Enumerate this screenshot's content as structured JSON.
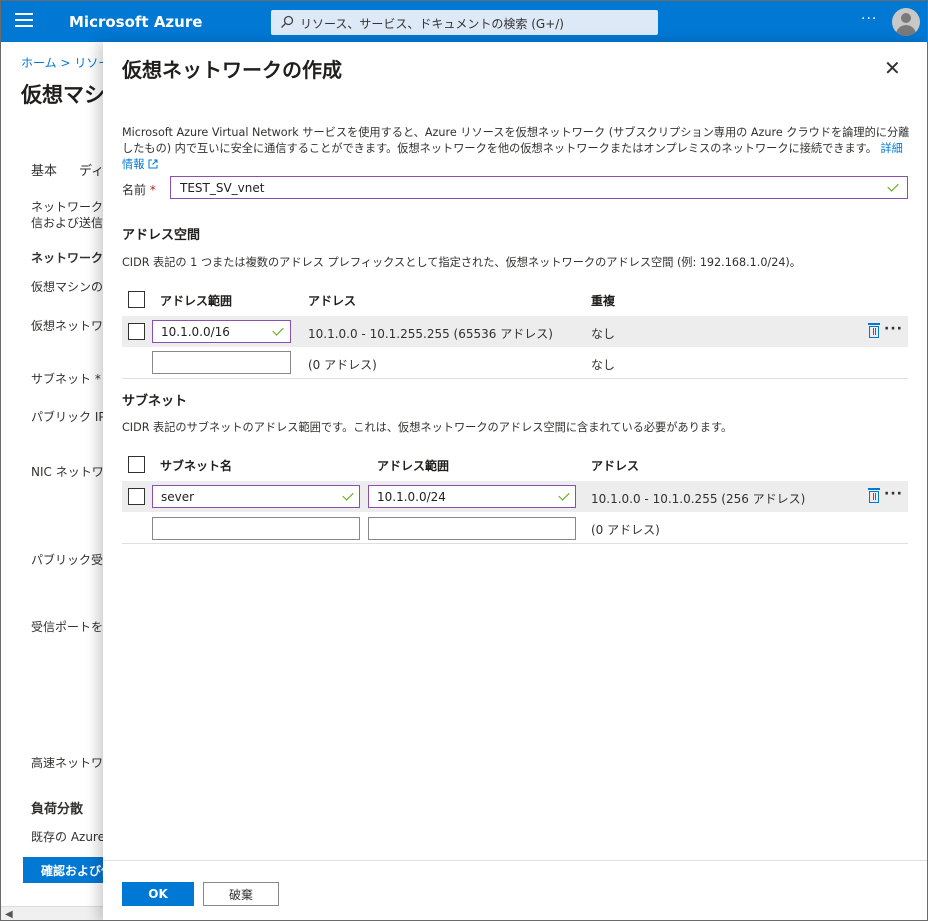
{
  "topbar": {
    "brand": "Microsoft Azure",
    "search_placeholder": "リソース、サービス、ドキュメントの検索 (G+/)",
    "more": "···"
  },
  "background": {
    "breadcrumb": "ホーム > リソー",
    "title": "仮想マシ",
    "tabs": [
      "基本",
      "ディ"
    ],
    "texts": [
      "ネットワーク イン",
      "信および送信ま",
      "ネットワーク イ",
      "仮想マシンの作",
      "仮想ネットワー",
      "サブネット *",
      "パブリック IP",
      "NIC ネットワーク",
      "パブリック受信ポ",
      "受信ポートを選",
      "高速ネットワー",
      "負荷分散",
      "既存の Azure"
    ],
    "button": "確認および作"
  },
  "panel": {
    "title": "仮想ネットワークの作成",
    "close": "✕",
    "description": "Microsoft Azure Virtual Network サービスを使用すると、Azure リソースを仮想ネットワーク (サブスクリプション専用の Azure クラウドを論理的に分離したもの) 内で互いに安全に通信することができます。仮想ネットワークを他の仮想ネットワークまたはオンプレミスのネットワークに接続できます。",
    "learn_more": "詳細情報",
    "name_label": "名前",
    "name_value": "TEST_SV_vnet",
    "address_space": {
      "heading": "アドレス空間",
      "description": "CIDR 表記の 1 つまたは複数のアドレス プレフィックスとして指定された、仮想ネットワークのアドレス空間 (例: 192.168.1.0/24)。",
      "columns": [
        "アドレス範囲",
        "アドレス",
        "重複"
      ],
      "rows": [
        {
          "range": "10.1.0.0/16",
          "address": "10.1.0.0 - 10.1.255.255 (65536 アドレス)",
          "overlap": "なし"
        },
        {
          "range": "",
          "address": "(0 アドレス)",
          "overlap": "なし"
        }
      ]
    },
    "subnet": {
      "heading": "サブネット",
      "description": "CIDR 表記のサブネットのアドレス範囲です。これは、仮想ネットワークのアドレス空間に含まれている必要があります。",
      "columns": [
        "サブネット名",
        "アドレス範囲",
        "アドレス"
      ],
      "rows": [
        {
          "name": "sever",
          "range": "10.1.0.0/24",
          "address": "10.1.0.0 - 10.1.0.255 (256 アドレス)"
        },
        {
          "name": "",
          "range": "",
          "address": "(0 アドレス)"
        }
      ]
    },
    "ok": "OK",
    "cancel": "破棄"
  },
  "colors": {
    "accent": "#0078d4",
    "valid_border": "#8a4fb1",
    "check": "#57a300"
  }
}
